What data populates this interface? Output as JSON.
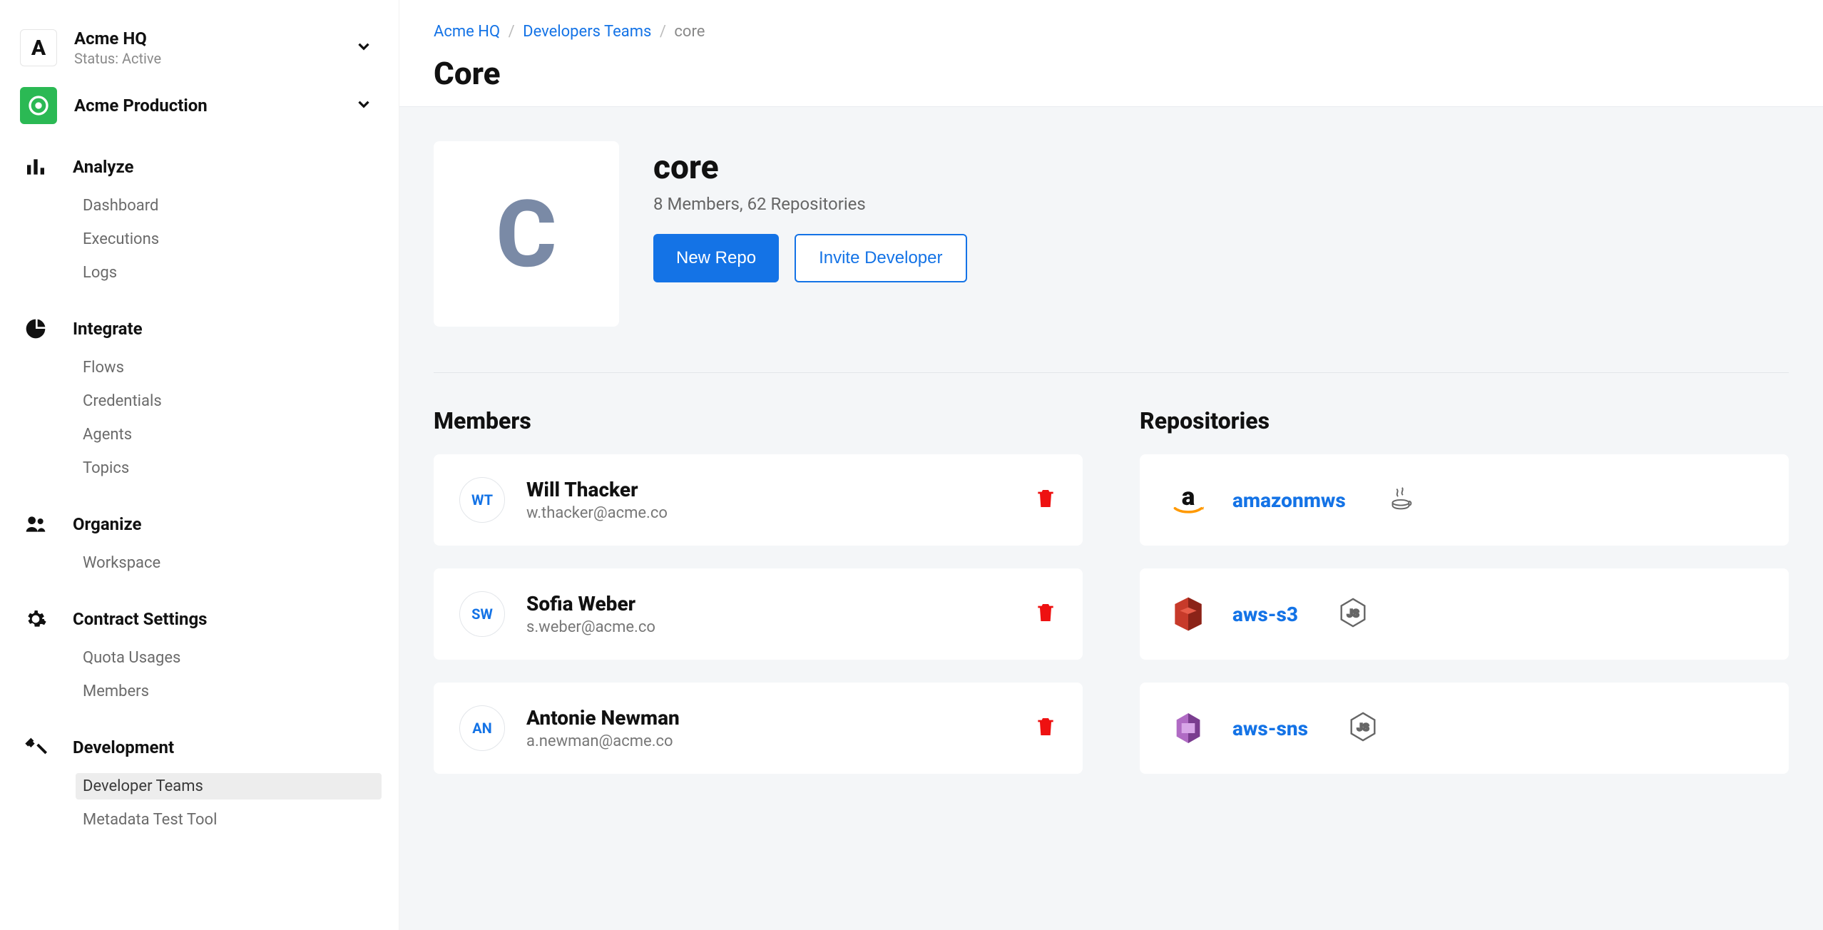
{
  "sidebar": {
    "org1": {
      "name": "Acme HQ",
      "status": "Status: Active",
      "logo_letter": "A"
    },
    "org2": {
      "name": "Acme Production"
    },
    "sections": {
      "analyze": {
        "label": "Analyze",
        "items": [
          "Dashboard",
          "Executions",
          "Logs"
        ]
      },
      "integrate": {
        "label": "Integrate",
        "items": [
          "Flows",
          "Credentials",
          "Agents",
          "Topics"
        ]
      },
      "organize": {
        "label": "Organize",
        "items": [
          "Workspace"
        ]
      },
      "contract": {
        "label": "Contract Settings",
        "items": [
          "Quota Usages",
          "Members"
        ]
      },
      "development": {
        "label": "Development",
        "items": [
          "Developer Teams",
          "Metadata Test Tool"
        ],
        "active_index": 0
      }
    }
  },
  "breadcrumb": {
    "root": "Acme HQ",
    "level1": "Developers Teams",
    "level2": "core"
  },
  "page_title": "Core",
  "team": {
    "avatar_letter": "C",
    "name": "core",
    "meta": "8 Members, 62 Repositories",
    "actions": {
      "primary": "New Repo",
      "secondary": "Invite Developer"
    }
  },
  "sections": {
    "members_heading": "Members",
    "repos_heading": "Repositories"
  },
  "members": [
    {
      "initials": "WT",
      "name": "Will Thacker",
      "email": "w.thacker@acme.co"
    },
    {
      "initials": "SW",
      "name": "Sofia Weber",
      "email": "s.weber@acme.co"
    },
    {
      "initials": "AN",
      "name": "Antonie Newman",
      "email": "a.newman@acme.co"
    }
  ],
  "repositories": [
    {
      "name": "amazonmws",
      "logo": "amazon",
      "lang": "java"
    },
    {
      "name": "aws-s3",
      "logo": "aws-s3",
      "lang": "nodejs"
    },
    {
      "name": "aws-sns",
      "logo": "aws-sns",
      "lang": "nodejs"
    }
  ]
}
